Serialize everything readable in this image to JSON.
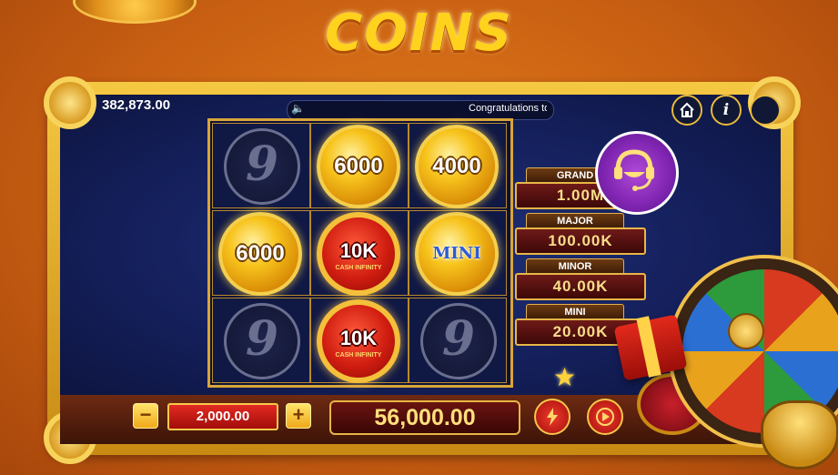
{
  "game": {
    "title": "COINS"
  },
  "topbar": {
    "balance": "382,873.00",
    "marquee_text": "Congratulations to",
    "speaker_icon": "speaker-icon",
    "home_icon": "home-icon",
    "info_label": "i"
  },
  "reels": {
    "cells": [
      {
        "type": "nine",
        "label": "9"
      },
      {
        "type": "gold",
        "label": "6000"
      },
      {
        "type": "gold",
        "label": "4000"
      },
      {
        "type": "gold",
        "label": "6000"
      },
      {
        "type": "red",
        "label": "10K",
        "sub": "CASH INFINITY"
      },
      {
        "type": "mini",
        "label": "MINI"
      },
      {
        "type": "nine",
        "label": "9"
      },
      {
        "type": "red",
        "label": "10K",
        "sub": "CASH INFINITY"
      },
      {
        "type": "nine",
        "label": "9"
      }
    ]
  },
  "jackpots": [
    {
      "name": "GRAND",
      "value": "1.00M"
    },
    {
      "name": "MAJOR",
      "value": "100.00K"
    },
    {
      "name": "MINOR",
      "value": "40.00K"
    },
    {
      "name": "MINI",
      "value": "20.00K"
    }
  ],
  "controls": {
    "minus_label": "−",
    "plus_label": "+",
    "bet": "2,000.00",
    "win": "56,000.00",
    "turbo_icon": "lightning-icon",
    "autoplay_icon": "play-icon"
  },
  "colors": {
    "background": "#c85f12",
    "accent_gold": "#f7c31c",
    "screen_blue": "#141f5a"
  }
}
